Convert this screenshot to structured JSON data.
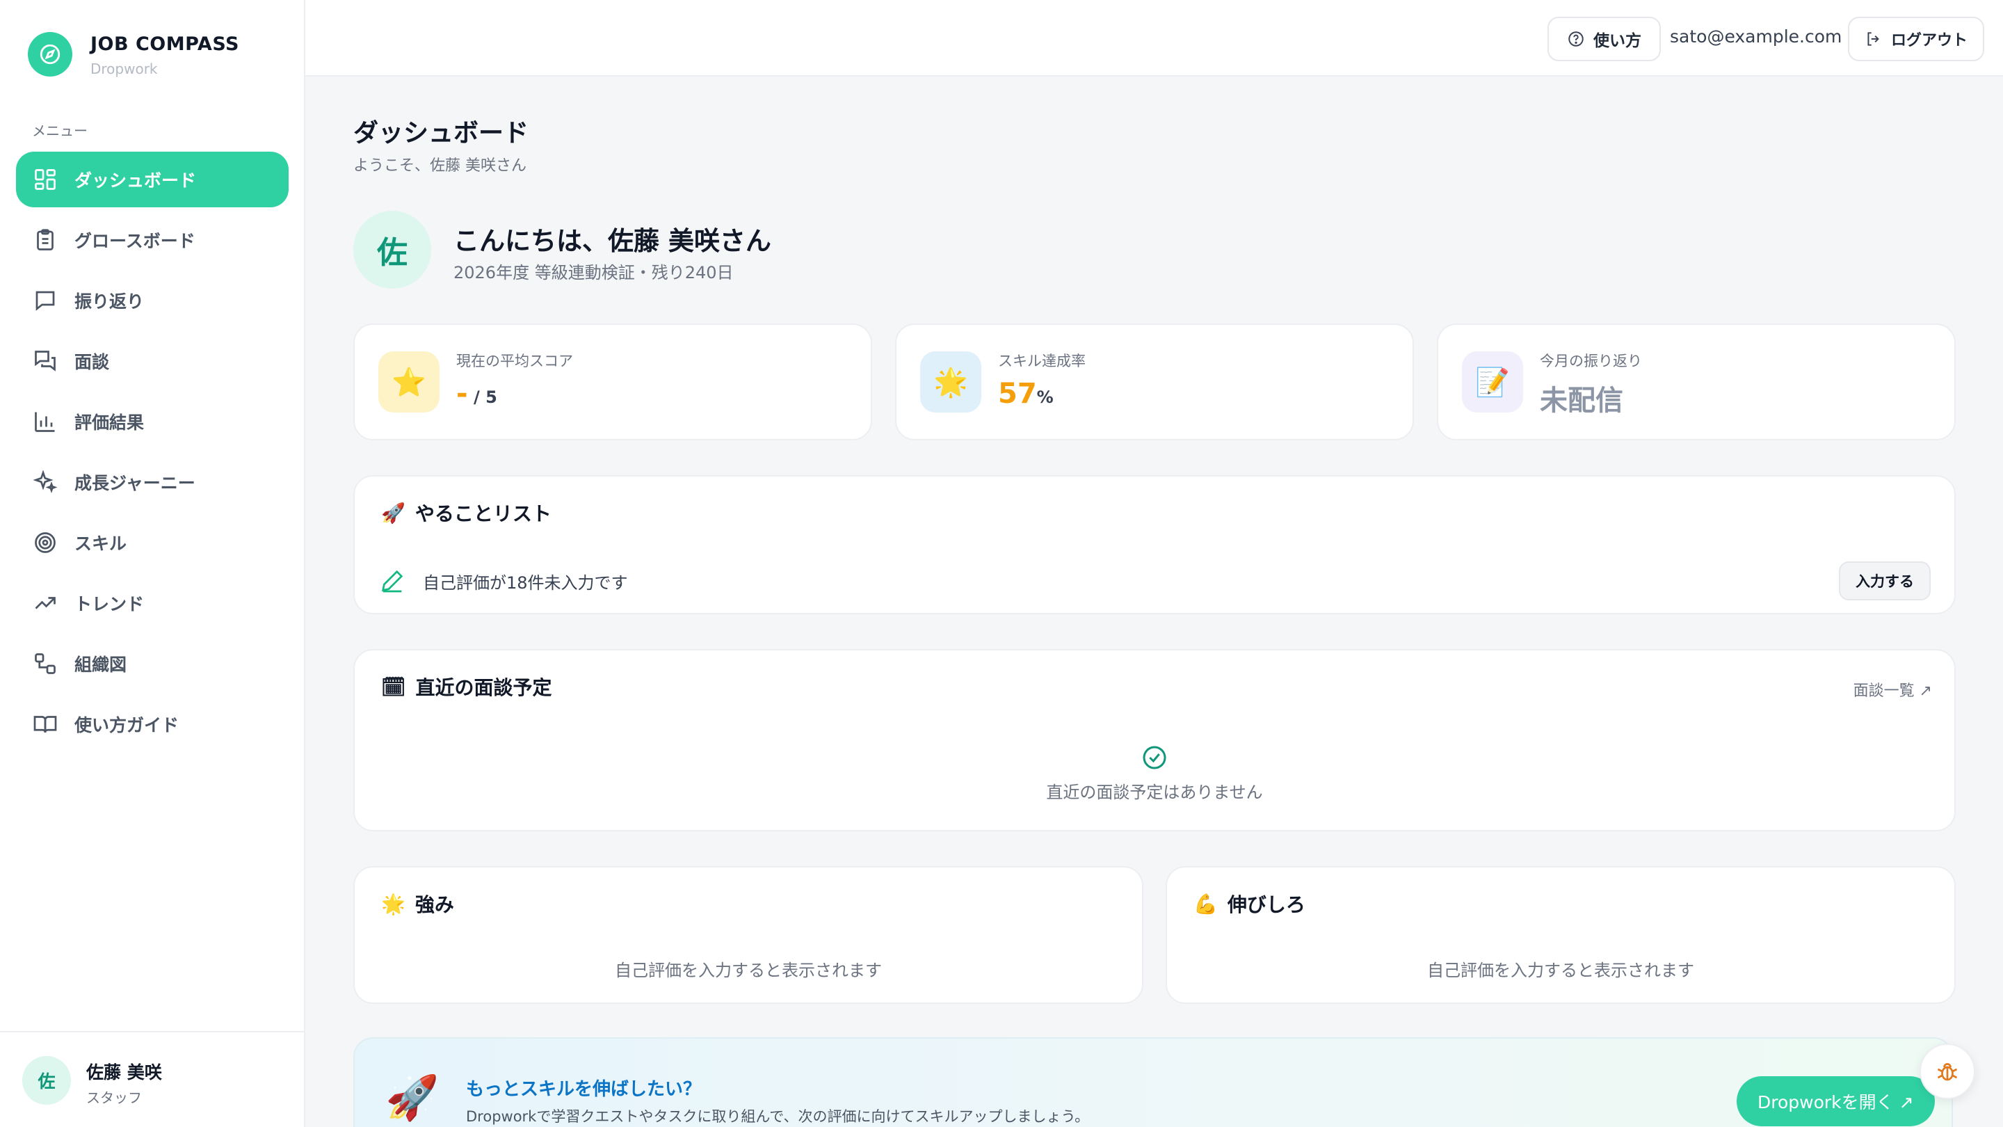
{
  "brand": {
    "title": "JOB COMPASS",
    "subtitle": "Dropwork"
  },
  "sidebar": {
    "menu_caption": "メニュー",
    "items": [
      {
        "label": "ダッシュボード",
        "icon": "grid-icon",
        "active": true
      },
      {
        "label": "グロースボード",
        "icon": "clipboard-icon"
      },
      {
        "label": "振り返り",
        "icon": "chat-icon"
      },
      {
        "label": "面談",
        "icon": "chats-icon"
      },
      {
        "label": "評価結果",
        "icon": "bar-chart-icon"
      },
      {
        "label": "成長ジャーニー",
        "icon": "sparkles-icon"
      },
      {
        "label": "スキル",
        "icon": "target-icon"
      },
      {
        "label": "トレンド",
        "icon": "trend-icon"
      },
      {
        "label": "組織図",
        "icon": "org-icon"
      },
      {
        "label": "使い方ガイド",
        "icon": "book-icon"
      }
    ],
    "user": {
      "avatar": "佐",
      "name": "佐藤 美咲",
      "role": "スタッフ"
    }
  },
  "header": {
    "help_label": "使い方",
    "email": "sato@example.com",
    "logout_label": "ログアウト"
  },
  "page": {
    "title": "ダッシュボード",
    "subtitle": "ようこそ、佐藤 美咲さん"
  },
  "greeting": {
    "avatar": "佐",
    "title": "こんにちは、佐藤 美咲さん",
    "subtitle": "2026年度 等級連動検証・残り240日"
  },
  "stats": [
    {
      "label": "現在の平均スコア",
      "value": "-",
      "unit": " / 5",
      "icon": "⭐",
      "value_color": "#f59e0b",
      "unit_color": "#374151",
      "icon_bg": "#fdf3c7"
    },
    {
      "label": "スキル達成率",
      "value": "57",
      "unit": "%",
      "icon": "🌟",
      "value_color": "#f59e0b",
      "unit_color": "#374151",
      "icon_bg": "#e0f0fb"
    },
    {
      "label": "今月の振り返り",
      "value": "未配信",
      "unit": "",
      "icon": "📝",
      "value_color": "#8b95a5",
      "unit_color": "#8b95a5",
      "icon_bg": "#f1effb"
    }
  ],
  "todo": {
    "title": "やることリスト",
    "title_emoji": "🚀",
    "item_text": "自己評価が18件未入力です",
    "item_button": "入力する"
  },
  "interviews": {
    "title": "直近の面談予定",
    "title_emoji": "🗓",
    "link": "面談一覧 ↗",
    "empty": "直近の面談予定はありません"
  },
  "strengths": {
    "title": "強み",
    "title_emoji": "🌟",
    "empty": "自己評価を入力すると表示されます"
  },
  "growth": {
    "title": "伸びしろ",
    "title_emoji": "💪",
    "empty": "自己評価を入力すると表示されます"
  },
  "promo": {
    "title": "もっとスキルを伸ばしたい？",
    "text": "Dropworkで学習クエストやタスクに取り組んで、次の評価に向けてスキルアップしましょう。",
    "button": "Dropworkを開く ↗",
    "emoji": "🚀"
  },
  "colors": {
    "accent": "#2fd1a3",
    "accent_dark": "#10977a",
    "link_blue": "#0b74c5",
    "warning": "#f59e0b"
  }
}
